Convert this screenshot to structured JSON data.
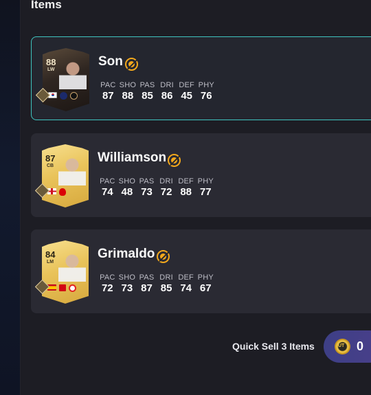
{
  "section_title": "Items",
  "items": [
    {
      "name": "Son",
      "card": {
        "rating": "88",
        "position": "LW",
        "style": "special"
      },
      "stats": [
        {
          "label": "PAC",
          "value": "87"
        },
        {
          "label": "SHO",
          "value": "88"
        },
        {
          "label": "PAS",
          "value": "85"
        },
        {
          "label": "DRI",
          "value": "86"
        },
        {
          "label": "DEF",
          "value": "45"
        },
        {
          "label": "PHY",
          "value": "76"
        }
      ],
      "selected": true
    },
    {
      "name": "Williamson",
      "card": {
        "rating": "87",
        "position": "CB",
        "style": "gold"
      },
      "stats": [
        {
          "label": "PAC",
          "value": "74"
        },
        {
          "label": "SHO",
          "value": "48"
        },
        {
          "label": "PAS",
          "value": "73"
        },
        {
          "label": "DRI",
          "value": "72"
        },
        {
          "label": "DEF",
          "value": "88"
        },
        {
          "label": "PHY",
          "value": "77"
        }
      ],
      "selected": false
    },
    {
      "name": "Grimaldo",
      "card": {
        "rating": "84",
        "position": "LM",
        "style": "gold"
      },
      "stats": [
        {
          "label": "PAC",
          "value": "72"
        },
        {
          "label": "SHO",
          "value": "73"
        },
        {
          "label": "PAS",
          "value": "87"
        },
        {
          "label": "DRI",
          "value": "85"
        },
        {
          "label": "DEF",
          "value": "74"
        },
        {
          "label": "PHY",
          "value": "67"
        }
      ],
      "selected": false
    }
  ],
  "quick_sell": {
    "label": "Quick Sell 3 Items",
    "coin_text": "UT",
    "value": "0"
  },
  "colors": {
    "selected_border": "#3fc6c1",
    "untradeable": "#f3a81c",
    "quick_sell_button": "#3d3f86"
  }
}
